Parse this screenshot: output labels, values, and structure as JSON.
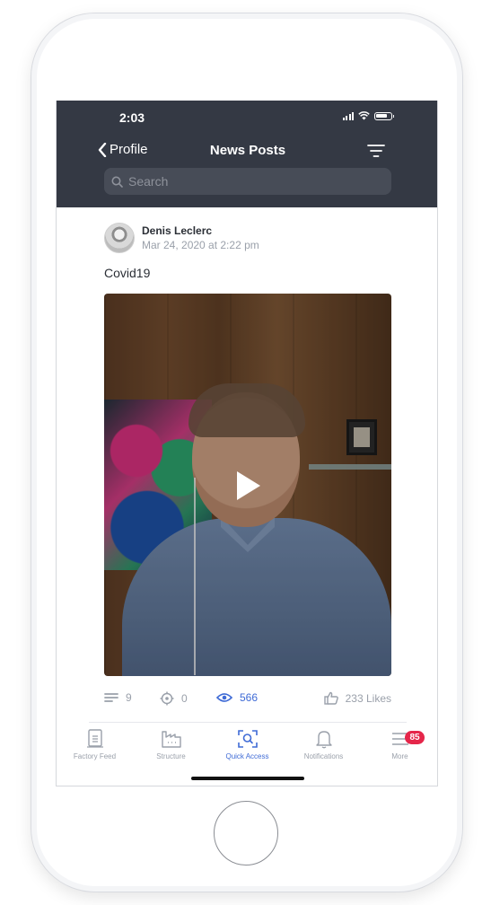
{
  "status_bar": {
    "time": "2:03"
  },
  "nav": {
    "back_label": "Profile",
    "title": "News Posts"
  },
  "search": {
    "placeholder": "Search"
  },
  "post": {
    "author": "Denis Leclerc",
    "date": "Mar 24, 2020 at 2:22 pm",
    "text": "Covid19",
    "stats": {
      "comments": "9",
      "targets": "0",
      "views": "566",
      "likes": "233 Likes"
    }
  },
  "tabbar": {
    "tabs": [
      {
        "label": "Factory Feed",
        "icon": "feed-icon"
      },
      {
        "label": "Structure",
        "icon": "factory-icon"
      },
      {
        "label": "Quick Access",
        "icon": "scan-icon",
        "active": true
      },
      {
        "label": "Notifications",
        "icon": "bell-icon"
      },
      {
        "label": "More",
        "icon": "menu-icon",
        "badge": "85"
      }
    ]
  },
  "colors": {
    "header_bg": "#343944",
    "accent": "#3f6bd6",
    "badge": "#e5264a"
  }
}
